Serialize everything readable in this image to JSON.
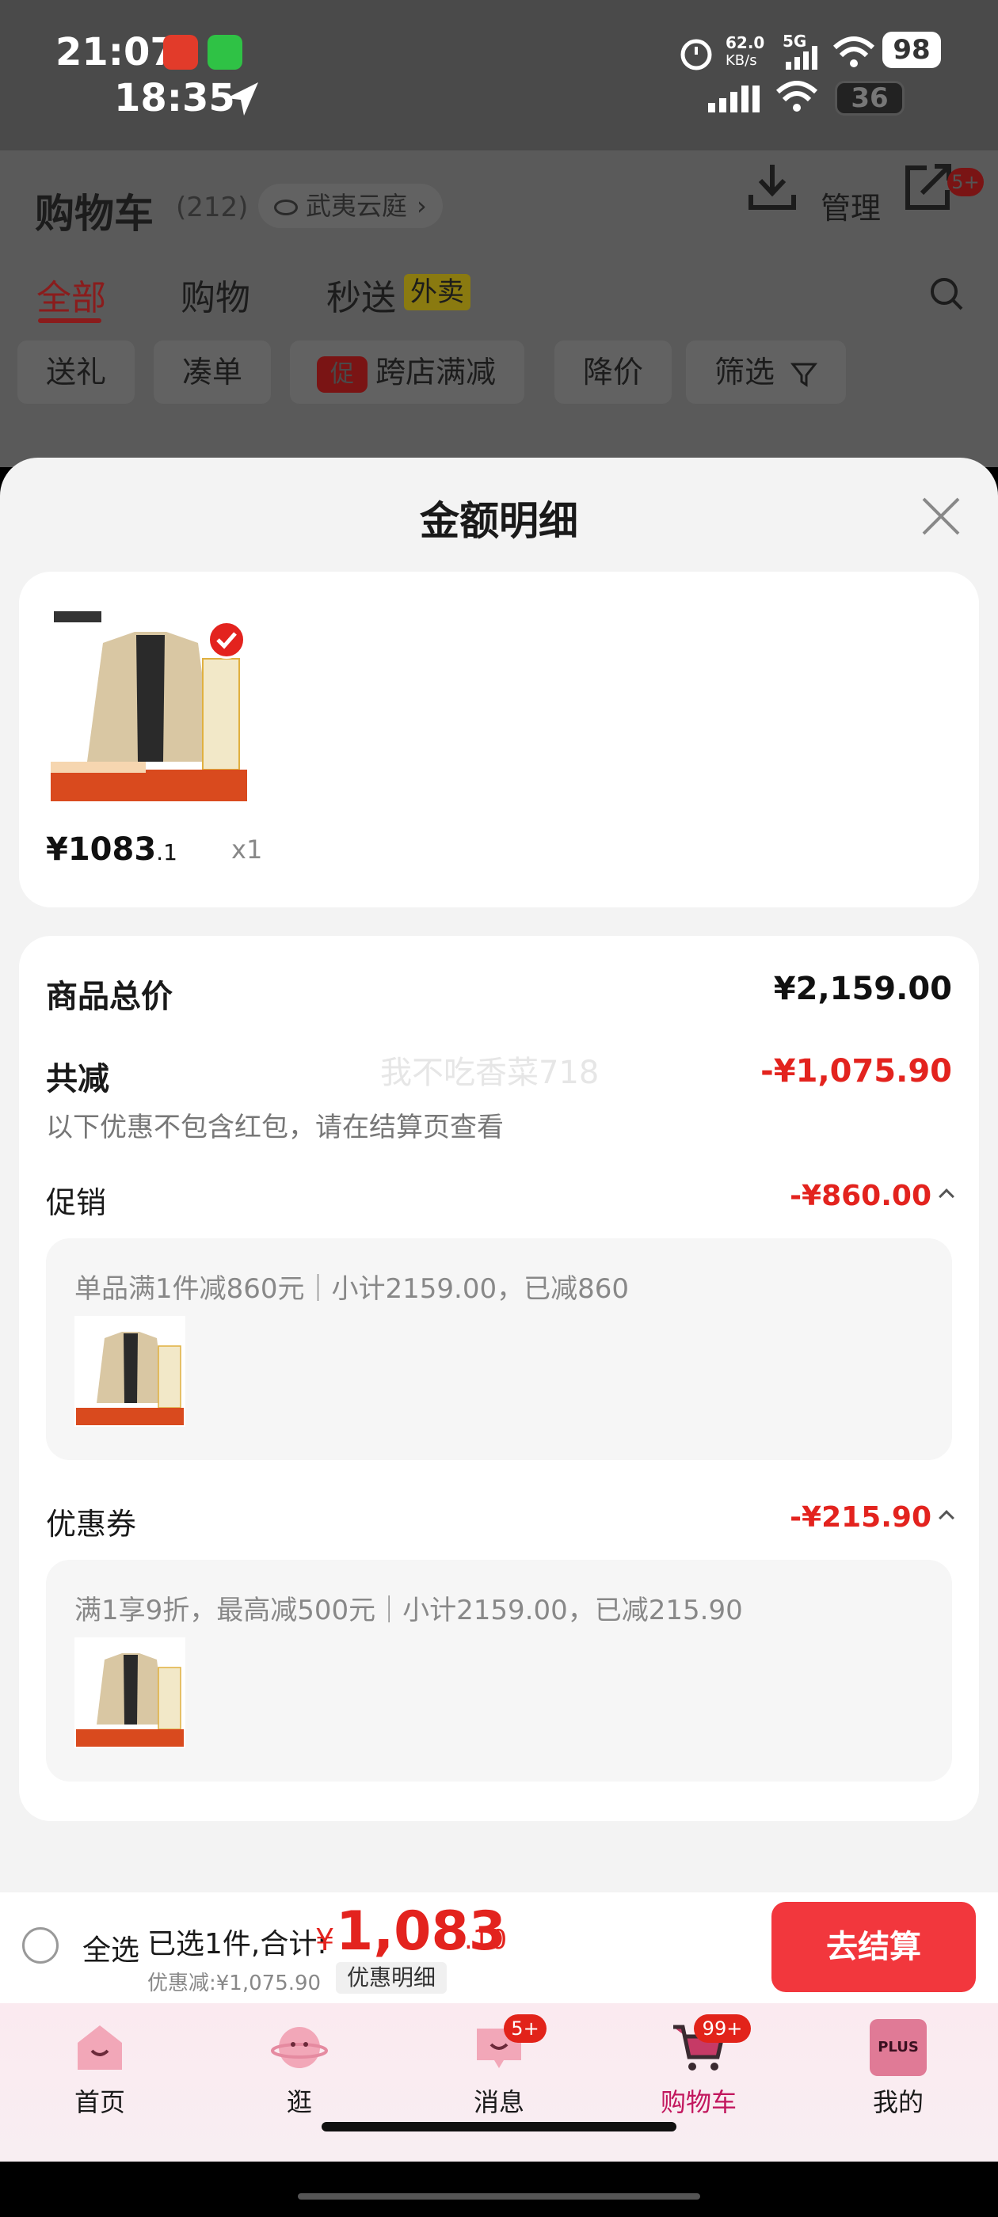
{
  "status": {
    "time_top": "21:07",
    "time_second": "18:35",
    "net_speed_value": "62.0",
    "net_speed_unit": "KB/s",
    "net_type": "5G",
    "battery_top": "98",
    "battery_second": "36"
  },
  "background": {
    "title": "购物车",
    "count": "(212)",
    "address": "武夷云庭",
    "manage_label": "管理",
    "share_badge": "5+",
    "tabs": [
      {
        "label": "全部"
      },
      {
        "label": "购物"
      },
      {
        "label": "秒送"
      }
    ],
    "waimai_tag": "外卖",
    "filters": [
      {
        "label": "送礼"
      },
      {
        "label": "凑单"
      },
      {
        "label": "跨店满减"
      },
      {
        "label": "降价"
      },
      {
        "label": "筛选"
      }
    ],
    "promo_tag": "促"
  },
  "sheet": {
    "title": "金额明细",
    "product": {
      "price_main": "¥1083",
      "price_dec": ".1",
      "qty": "x1"
    },
    "summary": {
      "goods_total_label": "商品总价",
      "goods_total_value": "¥2,159.00",
      "total_discount_label": "共减",
      "total_discount_value": "-¥1,075.90",
      "note": "以下优惠不包含红包，请在结算页查看",
      "watermark": "我不吃香菜718"
    },
    "promotion": {
      "label": "促销",
      "value": "-¥860.00",
      "rule": "单品满1件减860元｜小计2159.00，已减860"
    },
    "coupon": {
      "label": "优惠券",
      "value": "-¥215.90",
      "rule": "满1享9折，最高减500元｜小计2159.00，已减215.90"
    }
  },
  "checkout": {
    "select_all": "全选",
    "selected_text": "已选1件,合计:",
    "yen": "¥",
    "total_int": "1,083",
    "total_dec": ".10",
    "discount_line": "优惠减:¥1,075.90",
    "detail_chip": "优惠明细",
    "button": "去结算"
  },
  "tabbar": {
    "items": [
      {
        "label": "首页"
      },
      {
        "label": "逛"
      },
      {
        "label": "消息",
        "badge": "5+"
      },
      {
        "label": "购物车",
        "badge": "99+"
      },
      {
        "label": "我的",
        "icon_text": "PLUS"
      }
    ]
  },
  "colors": {
    "accent_red": "#e3231e",
    "checkout_button": "#f2373d",
    "active_tab": "#c2175e"
  }
}
